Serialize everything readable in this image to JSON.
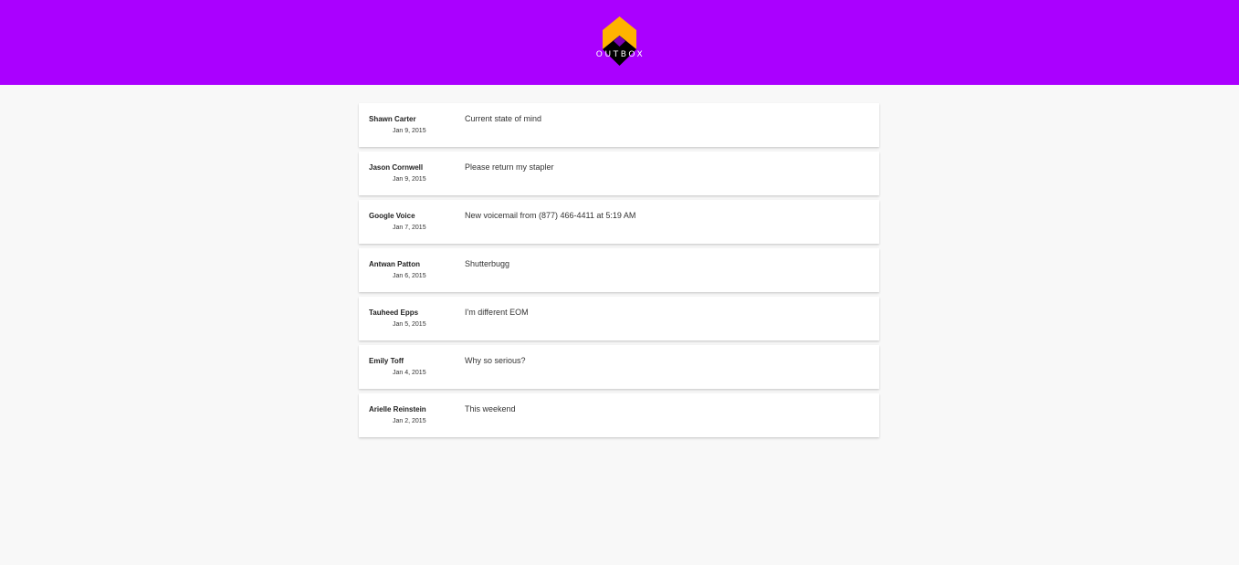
{
  "app": {
    "logo_text": "OUTBOX",
    "brand_color": "#aa00ff",
    "logo_colors": {
      "top": "#ffb300",
      "bottom": "#000000"
    }
  },
  "messages": [
    {
      "sender": "Shawn Carter",
      "date": "Jan 9, 2015",
      "subject": "Current state of mind"
    },
    {
      "sender": "Jason Cornwell",
      "date": "Jan 9, 2015",
      "subject": "Please return my stapler"
    },
    {
      "sender": "Google Voice",
      "date": "Jan 7, 2015",
      "subject": "New voicemail from (877) 466-4411 at 5:19 AM"
    },
    {
      "sender": "Antwan Patton",
      "date": "Jan 6, 2015",
      "subject": "Shutterbugg"
    },
    {
      "sender": "Tauheed Epps",
      "date": "Jan 5, 2015",
      "subject": "I'm different EOM"
    },
    {
      "sender": "Emily Toff",
      "date": "Jan 4, 2015",
      "subject": "Why so serious?"
    },
    {
      "sender": "Arielle Reinstein",
      "date": "Jan 2, 2015",
      "subject": "This weekend"
    }
  ]
}
